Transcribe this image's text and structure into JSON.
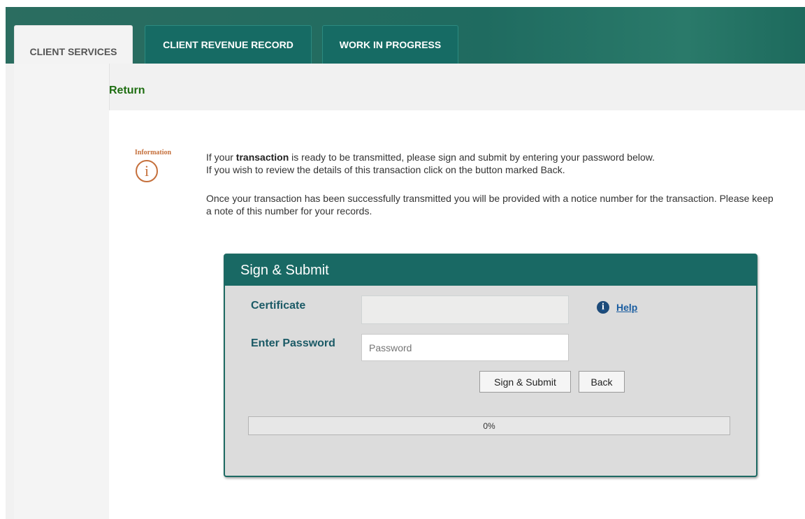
{
  "tabs": {
    "client_services": "CLIENT SERVICES",
    "client_revenue_record": "CLIENT REVENUE RECORD",
    "work_in_progress": "WORK IN PROGRESS"
  },
  "page": {
    "return_label": "Return"
  },
  "info": {
    "icon_title": "Information",
    "icon_glyph": "i",
    "line1_before": "If your ",
    "line1_bold": "transaction",
    "line1_after": " is ready to be transmitted, please sign and submit by entering your password below.",
    "line2": "If you wish to review the details of this transaction click on the button marked Back.",
    "paragraph2": "Once your transaction has been successfully transmitted you will be provided with a notice number for the transaction. Please keep a note of this number for your records."
  },
  "dialog": {
    "title": "Sign & Submit",
    "certificate_label": "Certificate",
    "certificate_value": "",
    "password_label": "Enter Password",
    "password_placeholder": "Password",
    "help_label": "Help",
    "help_icon": "i",
    "sign_submit_button": "Sign & Submit",
    "back_button": "Back",
    "progress_value": 0,
    "progress_text": "0%"
  },
  "colors": {
    "tab_bar": "#1f6b60",
    "dialog_header": "#196964",
    "return_text": "#1f6e12",
    "info_icon": "#c5703c",
    "label_text": "#1b5a66",
    "help_link": "#1b5ea1"
  }
}
